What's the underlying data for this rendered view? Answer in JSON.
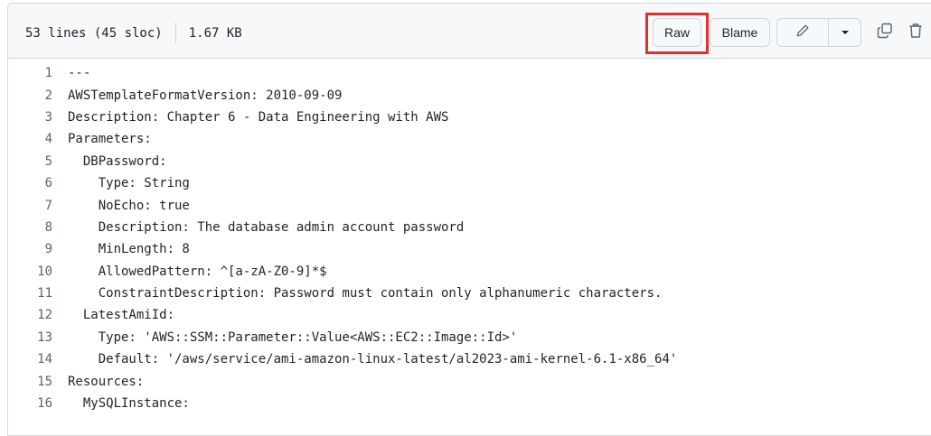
{
  "file": {
    "lines_info": "53 lines (45 sloc)",
    "size": "1.67 KB"
  },
  "toolbar": {
    "raw_label": "Raw",
    "blame_label": "Blame",
    "edit_icon": "pencil-icon",
    "dropdown_icon": "triangle-down-icon",
    "copy_icon": "copy-icon",
    "delete_icon": "trash-icon",
    "highlight_color": "#e0322a"
  },
  "code": {
    "lines": [
      {
        "n": "1",
        "text": "---"
      },
      {
        "n": "2",
        "text": "AWSTemplateFormatVersion: 2010-09-09"
      },
      {
        "n": "3",
        "text": "Description: Chapter 6 - Data Engineering with AWS"
      },
      {
        "n": "4",
        "text": "Parameters:"
      },
      {
        "n": "5",
        "text": "  DBPassword:"
      },
      {
        "n": "6",
        "text": "    Type: String"
      },
      {
        "n": "7",
        "text": "    NoEcho: true"
      },
      {
        "n": "8",
        "text": "    Description: The database admin account password"
      },
      {
        "n": "9",
        "text": "    MinLength: 8"
      },
      {
        "n": "10",
        "text": "    AllowedPattern: ^[a-zA-Z0-9]*$"
      },
      {
        "n": "11",
        "text": "    ConstraintDescription: Password must contain only alphanumeric characters."
      },
      {
        "n": "12",
        "text": "  LatestAmiId:"
      },
      {
        "n": "13",
        "text": "    Type: 'AWS::SSM::Parameter::Value<AWS::EC2::Image::Id>'"
      },
      {
        "n": "14",
        "text": "    Default: '/aws/service/ami-amazon-linux-latest/al2023-ami-kernel-6.1-x86_64'"
      },
      {
        "n": "15",
        "text": "Resources:"
      },
      {
        "n": "16",
        "text": "  MySQLInstance:"
      }
    ]
  }
}
